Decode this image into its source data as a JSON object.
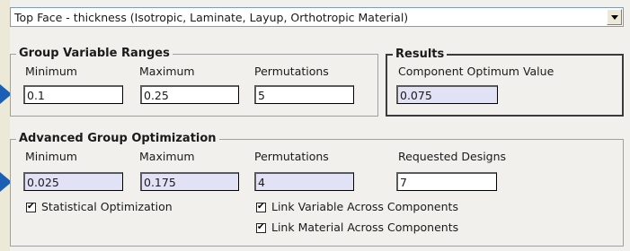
{
  "dropdown": {
    "value": "Top Face - thickness (Isotropic, Laminate, Layup, Orthotropic Material)"
  },
  "group_ranges": {
    "title": "Group Variable Ranges",
    "minimum_label": "Minimum",
    "maximum_label": "Maximum",
    "permutations_label": "Permutations",
    "minimum_value": "0.1",
    "maximum_value": "0.25",
    "permutations_value": "5"
  },
  "results": {
    "title": "Results",
    "component_optimum_label": "Component Optimum Value",
    "component_optimum_value": "0.075"
  },
  "advanced": {
    "title": "Advanced Group Optimization",
    "minimum_label": "Minimum",
    "maximum_label": "Maximum",
    "permutations_label": "Permutations",
    "requested_designs_label": "Requested Designs",
    "minimum_value": "0.025",
    "maximum_value": "0.175",
    "permutations_value": "4",
    "requested_designs_value": "7",
    "statistical_optimization_label": "Statistical Optimization",
    "link_variable_label": "Link Variable Across Components",
    "link_material_label": "Link Material Across Components"
  },
  "colors": {
    "callout_arrow": "#1a5fb4",
    "readonly_field": "#e2e2f6"
  }
}
